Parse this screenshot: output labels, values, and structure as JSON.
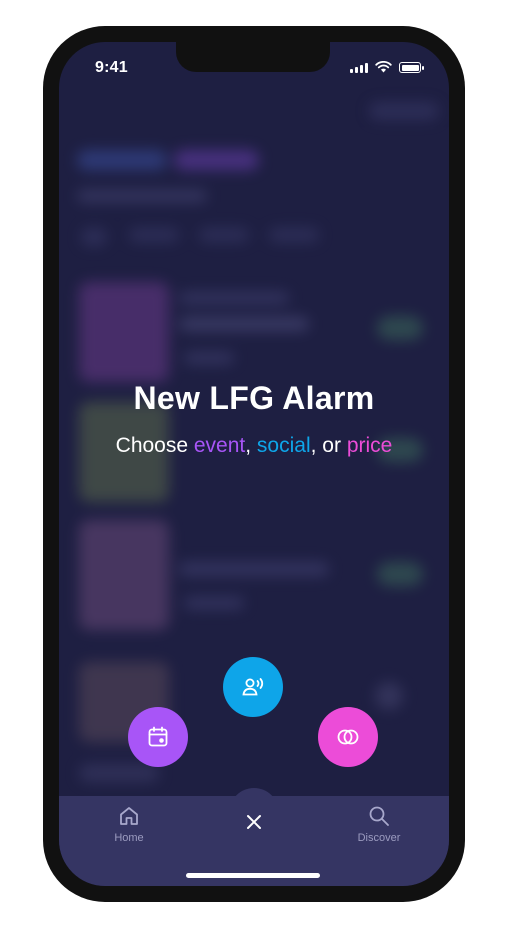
{
  "status_bar": {
    "time": "9:41"
  },
  "modal": {
    "title": "New LFG Alarm",
    "subtitle_prefix": "Choose ",
    "option_event": "event",
    "sep1": ", ",
    "option_social": "social",
    "sep2": ", or ",
    "option_price": "price"
  },
  "colors": {
    "event": "#a855f7",
    "social": "#0ea5e9",
    "price": "#ec4cd8",
    "background": "#1e1f42",
    "tabbar": "#353563"
  },
  "fab_buttons": [
    {
      "name": "event",
      "icon": "calendar-icon"
    },
    {
      "name": "social",
      "icon": "user-voice-icon"
    },
    {
      "name": "price",
      "icon": "coins-icon"
    }
  ],
  "tabbar": {
    "home_label": "Home",
    "discover_label": "Discover",
    "close_icon": "close-icon"
  }
}
